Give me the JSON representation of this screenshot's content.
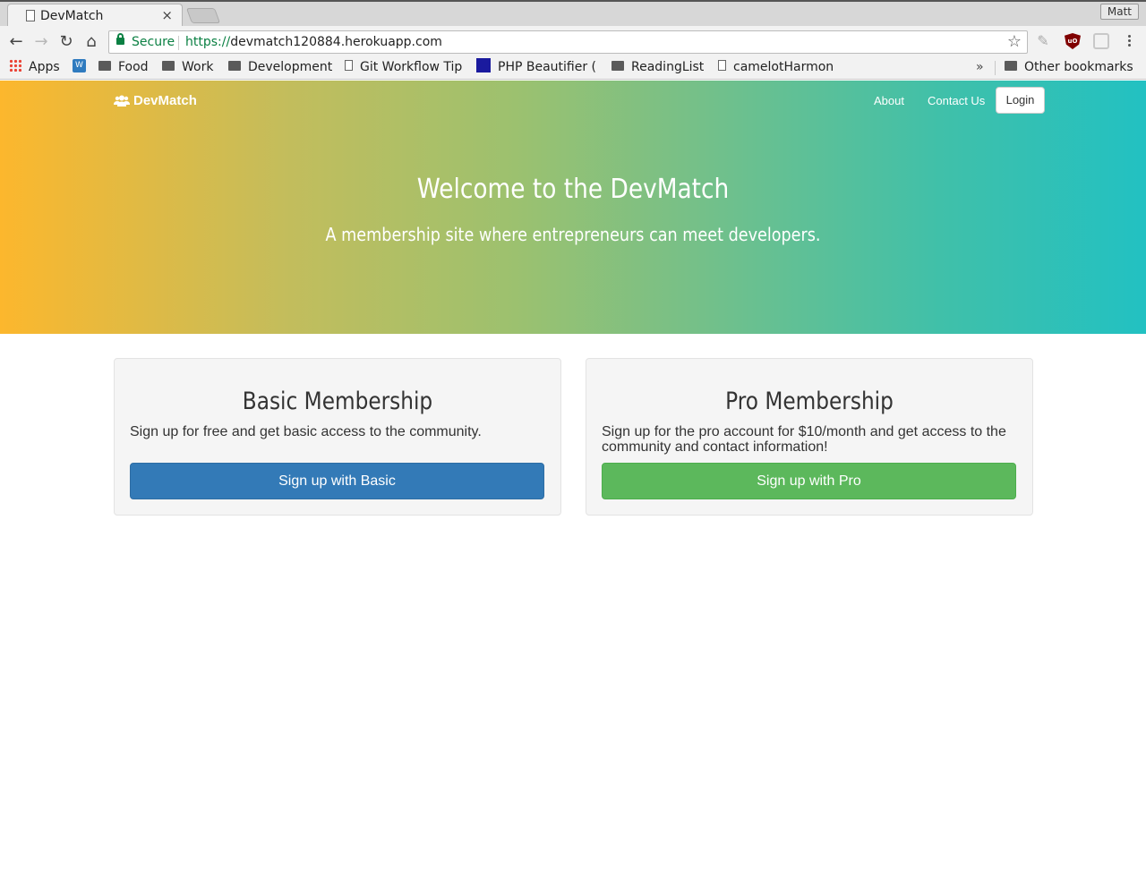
{
  "browser": {
    "tab_title": "DevMatch",
    "tab_close": "×",
    "profile_name": "Matt",
    "secure_label": "Secure",
    "url_scheme": "https://",
    "url_host": "devmatch120884.herokuapp.com",
    "bookmarks": {
      "apps": "Apps",
      "food": "Food",
      "work": "Work",
      "development": "Development",
      "git_workflow": "Git Workflow Tip",
      "php_beautifier": "PHP Beautifier (",
      "reading_list": "ReadingList",
      "camelot": "camelotHarmon",
      "overflow": "»",
      "other": "Other bookmarks"
    }
  },
  "site": {
    "brand": "DevMatch",
    "nav": {
      "about": "About",
      "contact": "Contact Us",
      "login": "Login"
    },
    "hero": {
      "title": "Welcome to the DevMatch",
      "subtitle": "A membership site where entrepreneurs can meet developers."
    },
    "plans": {
      "basic": {
        "title": "Basic Membership",
        "description": "Sign up for free and get basic access to the community.",
        "button": "Sign up with Basic"
      },
      "pro": {
        "title": "Pro Membership",
        "description": "Sign up for the pro account for $10/month and get access to the community and contact information!",
        "button": "Sign up with Pro"
      }
    }
  }
}
